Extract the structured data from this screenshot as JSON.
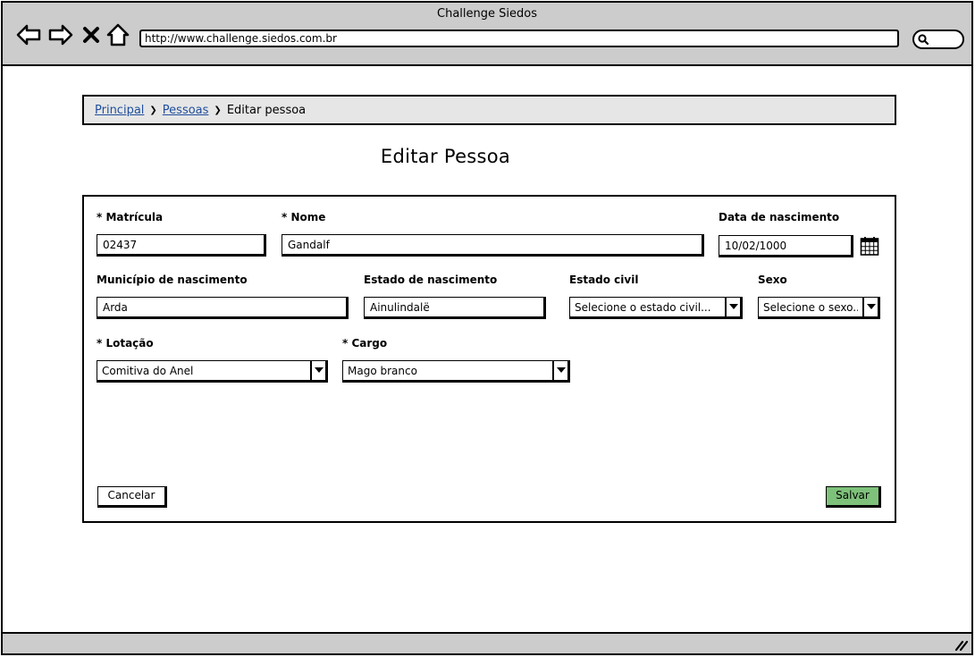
{
  "window": {
    "title": "Challenge Siedos"
  },
  "browser": {
    "url": "http://www.challenge.siedos.com.br"
  },
  "breadcrumb": {
    "home": "Principal",
    "people": "Pessoas",
    "current": "Editar pessoa"
  },
  "page": {
    "title": "Editar Pessoa"
  },
  "form": {
    "matricula": {
      "label": "* Matrícula",
      "value": "02437"
    },
    "nome": {
      "label": "* Nome",
      "value": "Gandalf"
    },
    "data_nascimento": {
      "label": "Data de nascimento",
      "value": "10/02/1000"
    },
    "municipio": {
      "label": "Município de nascimento",
      "value": "Arda"
    },
    "estado": {
      "label": "Estado de nascimento",
      "value": "Ainulindalë"
    },
    "estado_civil": {
      "label": "Estado civil",
      "value": "Selecione o estado civil..."
    },
    "sexo": {
      "label": "Sexo",
      "value": "Selecione o sexo..."
    },
    "lotacao": {
      "label": "* Lotação",
      "value": "Comitiva do Anel"
    },
    "cargo": {
      "label": "* Cargo",
      "value": "Mago branco"
    },
    "cancel_label": "Cancelar",
    "save_label": "Salvar"
  },
  "colors": {
    "chrome": "#cccccc",
    "save_button": "#7ec17a",
    "link": "#1f4e9c"
  }
}
